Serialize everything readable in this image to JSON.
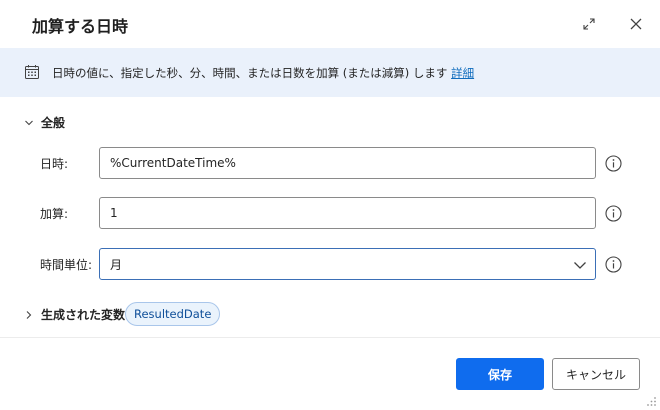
{
  "dialog": {
    "title": "加算する日時"
  },
  "info": {
    "text": "日時の値に、指定した秒、分、時間、または日数を加算 (または減算) します",
    "link": "詳細"
  },
  "general": {
    "label": "全般",
    "fields": {
      "datetime_label": "日時:",
      "datetime_value": "%CurrentDateTime%",
      "add_label": "加算:",
      "add_value": "1",
      "unit_label": "時間単位:",
      "unit_value": "月"
    }
  },
  "variables": {
    "label": "生成された変数",
    "badge": "ResultedDate"
  },
  "buttons": {
    "save": "保存",
    "cancel": "キャンセル"
  },
  "colors": {
    "accent": "#0f6cee",
    "info_bg": "#eaf1fb",
    "link": "#0f6cbd"
  },
  "icons": [
    "expand-icon",
    "close-icon",
    "calendar-icon",
    "chevron-down-icon",
    "chevron-right-icon",
    "info-circle-icon",
    "resize-grip-icon"
  ]
}
